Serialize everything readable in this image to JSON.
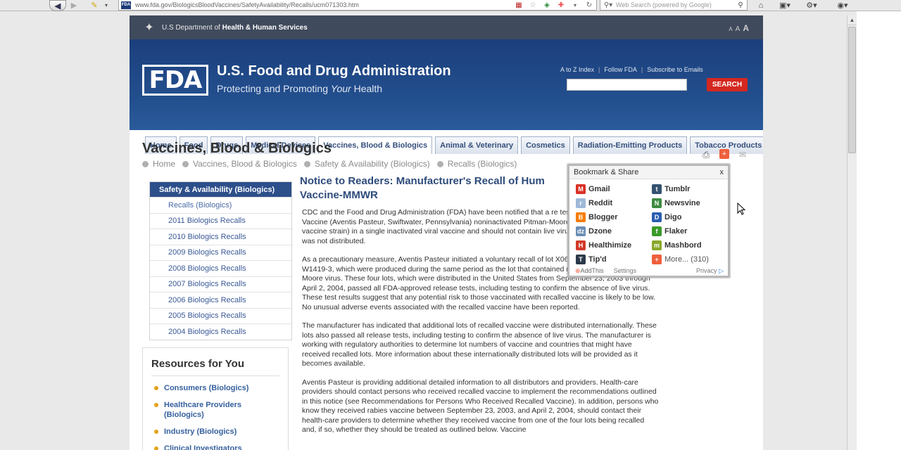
{
  "browser": {
    "url": "www.fda.gov/BiologicsBloodVaccines/SafetyAvailability/Recalls/ucm071303.htm",
    "url_favicon": "FDA",
    "search_placeholder": "Web Search (powered by Google)",
    "icons": {
      "back": "back-arrow-icon",
      "forward": "forward-arrow-icon",
      "edit": "pencil-icon",
      "flag": "us-flag-icon",
      "star": "star-icon",
      "reload": "reload-icon",
      "home": "home-icon"
    }
  },
  "hhs": {
    "prefix": "U.S Department of",
    "name": "Health & Human Services",
    "text_size": [
      "A",
      "A",
      "A"
    ]
  },
  "header": {
    "logo": "FDA",
    "agency": "U.S. Food and Drug Administration",
    "tagline_pre": "Protecting and Promoting",
    "tagline_em": "Your",
    "tagline_post": "Health",
    "links": [
      "A to Z Index",
      "Follow FDA",
      "Subscribe to Emails"
    ],
    "search_button": "SEARCH",
    "search_value": ""
  },
  "nav": {
    "tabs": [
      "Home",
      "Food",
      "Drugs",
      "Medical Devices",
      "Vaccines, Blood & Biologics",
      "Animal & Veterinary",
      "Cosmetics",
      "Radiation-Emitting Products",
      "Tobacco Products"
    ],
    "active_index": 4
  },
  "page": {
    "title": "Vaccines, Blood & Biologics",
    "breadcrumb": [
      "Home",
      "Vaccines, Blood & Biologics",
      "Safety & Availability (Biologics)",
      "Recalls (Biologics)"
    ]
  },
  "leftnav": {
    "heading": "Safety & Availability (Biologics)",
    "items": [
      "Recalls (Biologics)",
      "2011 Biologics Recalls",
      "2010 Biologics Recalls",
      "2009 Biologics Recalls",
      "2008 Biologics Recalls",
      "2007 Biologics Recalls",
      "2006 Biologics Recalls",
      "2005 Biologics Recalls",
      "2004 Biologics Recalls"
    ]
  },
  "resources": {
    "title": "Resources for You",
    "items": [
      "Consumers (Biologics)",
      "Healthcare Providers (Biologics)",
      "Industry (Biologics)",
      "Clinical Investigators"
    ]
  },
  "article": {
    "title_line1": "Notice to Readers: Manufacturer's Recall of Hum",
    "title_line2": "Vaccine-MMWR",
    "paragraphs": [
      "CDC and the Food and Drug Administration (FDA) have been notified that a re test of IMOVAX® Rabies Vaccine (Aventis Pasteur, Swiftwater, Pennsylvania) noninactivated Pitman-Moore virus (the attenuated vaccine strain) in a single inactivated viral vaccine and should not contain live virus. The vaccine lot conta was not distributed.",
      "As a precautionary measure, Aventis Pasteur initiated a voluntary recall of lot X0667-3, W1419-2, and W1419-3, which were produced during the same period as the lot that contained noninactivated Pitman-Moore virus. These four lots, which were distributed in the United States from September 23, 2003 through April 2, 2004, passed all FDA-approved release tests, including testing to confirm the absence of live virus. These test results suggest that any potential risk to those vaccinated with recalled vaccine is likely to be low. No unusual adverse events associated with the recalled vaccine have been reported.",
      "The manufacturer has indicated that additional lots of recalled vaccine were distributed internationally. These lots also passed all release tests, including testing to confirm the absence of live virus. The manufacturer is working with regulatory authorities to determine lot numbers of vaccine and countries that might have received recalled lots. More information about these internationally distributed lots will be provided as it becomes available.",
      "Aventis Pasteur is providing additional detailed information to all distributors and providers. Health-care providers should contact persons who received recalled vaccine to implement the recommendations outlined in this notice (see Recommendations for Persons Who Received Recalled Vaccine). In addition, persons who know they received rabies vaccine between September 23, 2003, and April 2, 2004, should contact their health-care providers to determine whether they received vaccine from one of the four lots being recalled and, if so, whether they should be treated as outlined below. Vaccine"
    ]
  },
  "share": {
    "heading": "Bookmark & Share",
    "close": "x",
    "services": [
      {
        "label": "Gmail",
        "icon": "gmail-icon",
        "color": "#d93025",
        "glyph": "M"
      },
      {
        "label": "Tumblr",
        "icon": "tumblr-icon",
        "color": "#34526f",
        "glyph": "t"
      },
      {
        "label": "Reddit",
        "icon": "reddit-icon",
        "color": "#9fb9d8",
        "glyph": "r"
      },
      {
        "label": "Newsvine",
        "icon": "newsvine-icon",
        "color": "#3d8c40",
        "glyph": "N"
      },
      {
        "label": "Blogger",
        "icon": "blogger-icon",
        "color": "#f57d00",
        "glyph": "B"
      },
      {
        "label": "Digo",
        "icon": "digo-icon",
        "color": "#2a5db0",
        "glyph": "D"
      },
      {
        "label": "Dzone",
        "icon": "dzone-icon",
        "color": "#6b8fb5",
        "glyph": "dz"
      },
      {
        "label": "Flaker",
        "icon": "flaker-icon",
        "color": "#3a9a2a",
        "glyph": "f"
      },
      {
        "label": "Healthimize",
        "icon": "healthimize-icon",
        "color": "#d1392b",
        "glyph": "H"
      },
      {
        "label": "Mashbord",
        "icon": "mashbord-icon",
        "color": "#8aa82a",
        "glyph": "m"
      },
      {
        "label": "Tip'd",
        "icon": "tipd-icon",
        "color": "#2b3a4a",
        "glyph": "T"
      },
      {
        "label": "More... (310)",
        "icon": "more-plus-icon",
        "color": "#ef5f3c",
        "glyph": "+"
      }
    ],
    "footer_addthis": "AddThis",
    "footer_settings": "Settings",
    "footer_privacy": "Privacy"
  }
}
